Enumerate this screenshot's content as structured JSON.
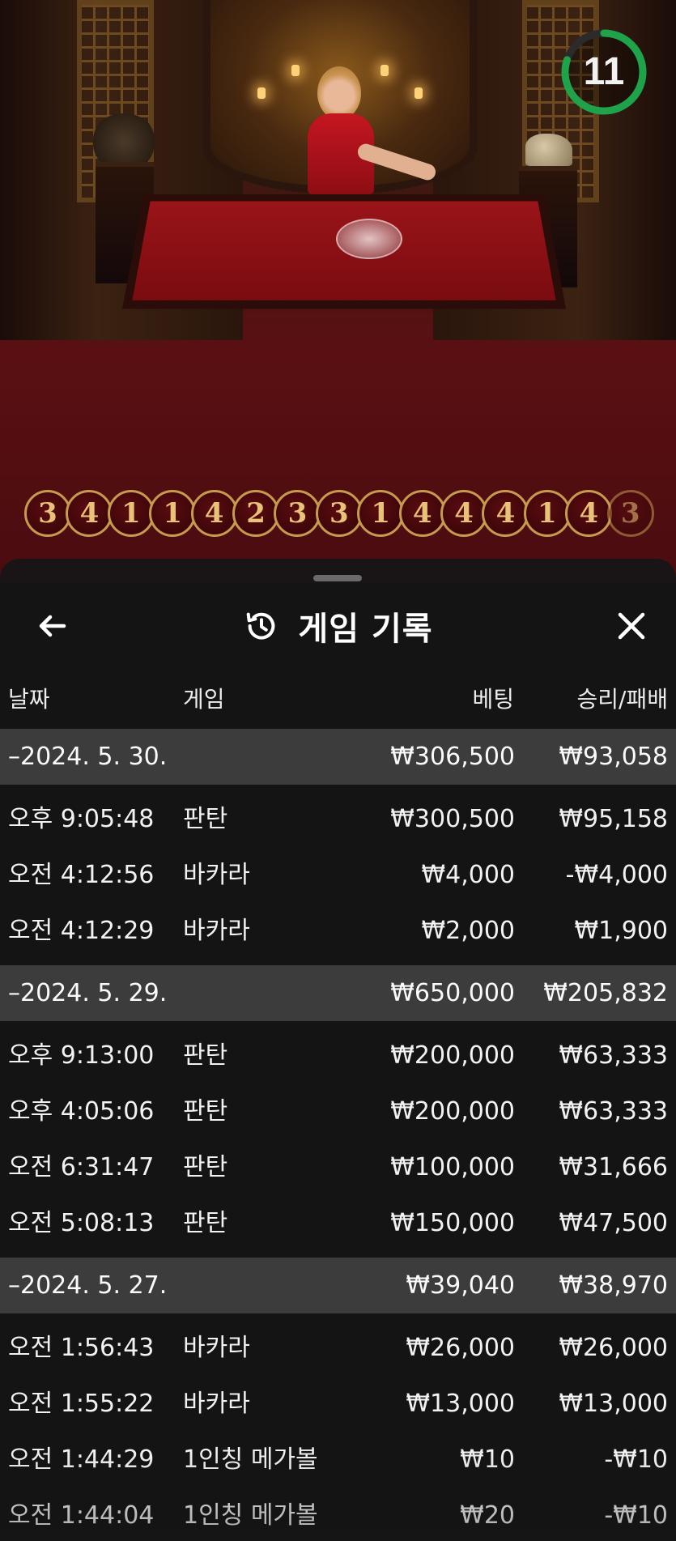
{
  "timer": {
    "seconds": "11",
    "remaining_fraction": 0.8,
    "color": "#1fa34a"
  },
  "roadmap": {
    "beads": [
      "3",
      "4",
      "1",
      "1",
      "4",
      "2",
      "3",
      "3",
      "1",
      "4",
      "4",
      "4",
      "1",
      "4",
      "3"
    ]
  },
  "modal": {
    "title": "게임 기록",
    "columns": {
      "date": "날짜",
      "game": "게임",
      "bet": "베팅",
      "win_loss": "승리/패배"
    },
    "days": [
      {
        "date": "–2024. 5. 30.",
        "bet_total": "₩306,500",
        "win_total": "₩93,058",
        "entries": [
          {
            "time": "오후 9:05:48",
            "game": "판탄",
            "bet": "₩300,500",
            "win": "₩95,158"
          },
          {
            "time": "오전 4:12:56",
            "game": "바카라",
            "bet": "₩4,000",
            "win": "-₩4,000"
          },
          {
            "time": "오전 4:12:29",
            "game": "바카라",
            "bet": "₩2,000",
            "win": "₩1,900"
          }
        ]
      },
      {
        "date": "–2024. 5. 29.",
        "bet_total": "₩650,000",
        "win_total": "₩205,832",
        "entries": [
          {
            "time": "오후 9:13:00",
            "game": "판탄",
            "bet": "₩200,000",
            "win": "₩63,333"
          },
          {
            "time": "오후 4:05:06",
            "game": "판탄",
            "bet": "₩200,000",
            "win": "₩63,333"
          },
          {
            "time": "오전 6:31:47",
            "game": "판탄",
            "bet": "₩100,000",
            "win": "₩31,666"
          },
          {
            "time": "오전 5:08:13",
            "game": "판탄",
            "bet": "₩150,000",
            "win": "₩47,500"
          }
        ]
      },
      {
        "date": "–2024. 5. 27.",
        "bet_total": "₩39,040",
        "win_total": "₩38,970",
        "entries": [
          {
            "time": "오전 1:56:43",
            "game": "바카라",
            "bet": "₩26,000",
            "win": "₩26,000"
          },
          {
            "time": "오전 1:55:22",
            "game": "바카라",
            "bet": "₩13,000",
            "win": "₩13,000"
          },
          {
            "time": "오전 1:44:29",
            "game": "1인칭 메가볼",
            "bet": "₩10",
            "win": "-₩10"
          },
          {
            "time": "오전 1:44:04",
            "game": "1인칭 메가볼",
            "bet": "₩20",
            "win": "-₩10"
          }
        ]
      }
    ]
  },
  "colors": {
    "sheet_bg": "#161616",
    "day_row_bg": "#3c3c3c",
    "bead_border": "#c79a4e",
    "bead_text": "#e8c277"
  },
  "icons": {
    "back": "arrow-left-icon",
    "history": "history-icon",
    "close": "close-icon"
  }
}
